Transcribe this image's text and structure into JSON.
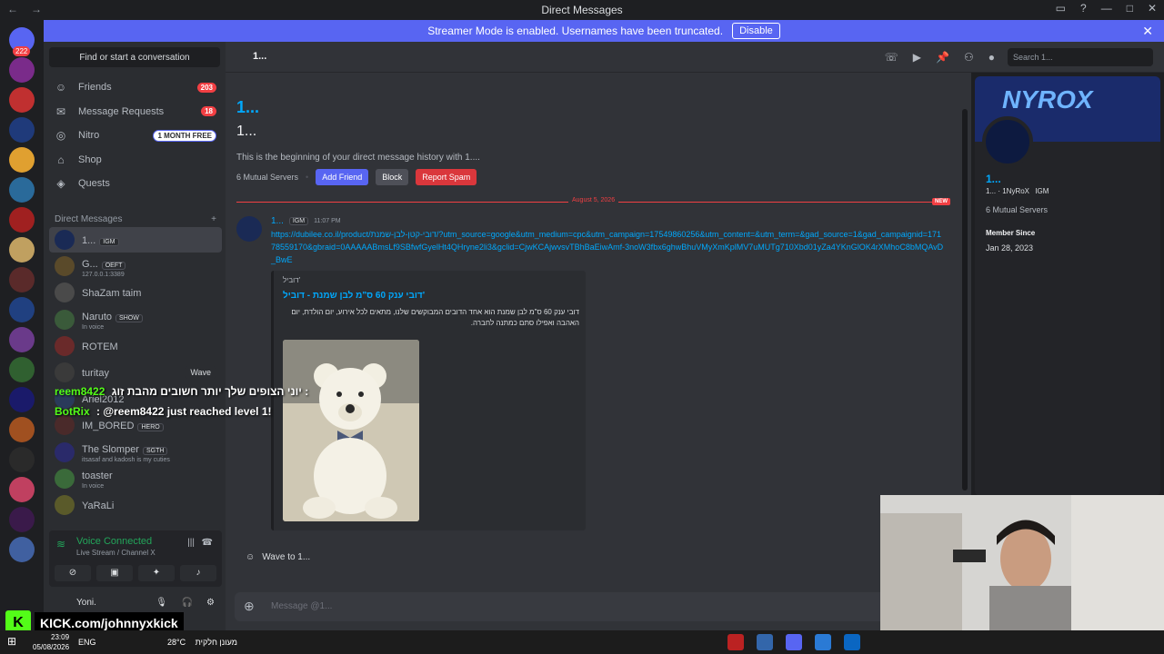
{
  "window": {
    "title": "Direct Messages"
  },
  "banner": {
    "text": "Streamer Mode is enabled. Usernames have been truncated.",
    "disable": "Disable"
  },
  "guilds": {
    "badge": "222",
    "colors": [
      "#5865f2",
      "#7a2b8a",
      "#c03030",
      "#1f3a7a",
      "#e0a030",
      "#2a6a9a",
      "#a02020",
      "#c0a060",
      "#5a2a2a",
      "#204080",
      "#6a3a8a",
      "#306030",
      "#1a1a6a",
      "#a05020",
      "#2a2a2a",
      "#c04060",
      "#3a1a4a",
      "#4060a0"
    ]
  },
  "sidebar": {
    "find": "Find or start a conversation",
    "nav": [
      {
        "label": "Friends",
        "icon": "friends-icon",
        "badge": "203"
      },
      {
        "label": "Message Requests",
        "icon": "mail-icon",
        "badge": "18"
      },
      {
        "label": "Nitro",
        "icon": "nitro-icon",
        "badge": "1 MONTH FREE"
      },
      {
        "label": "Shop",
        "icon": "shop-icon",
        "badge": ""
      },
      {
        "label": "Quests",
        "icon": "quests-icon",
        "badge": ""
      }
    ],
    "dm_header": "Direct Messages",
    "dms": [
      {
        "name": "1...",
        "tag": "IGM",
        "sub": ""
      },
      {
        "name": "G...",
        "tag": "OEFT",
        "sub": "127.0.0.1:3389"
      },
      {
        "name": "ShaZam taim",
        "tag": "",
        "sub": ""
      },
      {
        "name": "Naruto",
        "tag": "SHOW",
        "sub": "In voice"
      },
      {
        "name": "ROTEM",
        "tag": "",
        "sub": ""
      },
      {
        "name": "turitay",
        "tag": "",
        "sub": ""
      },
      {
        "name": "Ariel2012",
        "tag": "",
        "sub": ""
      },
      {
        "name": "IM_BORED",
        "tag": "HERO",
        "sub": ""
      },
      {
        "name": "The Slomper",
        "tag": "SGTH",
        "sub": "itsasaf and kadosh is my cuties"
      },
      {
        "name": "toaster",
        "tag": "",
        "sub": "In voice"
      },
      {
        "name": "YaRaLi",
        "tag": "",
        "sub": ""
      }
    ],
    "wave_label": "Wave",
    "voice": {
      "title": "Voice Connected",
      "sub": "Live Stream / Channel X"
    },
    "user": "Yoni."
  },
  "topbar": {
    "name": "1...",
    "search": "Search 1..."
  },
  "main": {
    "big_title": "1...",
    "sub_title": "1...",
    "begin": "This is the beginning of your direct message history with 1....",
    "mutual": "6 Mutual Servers",
    "add_friend": "Add Friend",
    "block": "Block",
    "report": "Report Spam",
    "date": "August 5, 2026",
    "new": "NEW",
    "msg": {
      "author": "1...",
      "tag": "IGM",
      "time": "11:07 PM",
      "link": "https://dubilee.co.il/product/דובי-קטן-לבן-שמנת/?utm_source=google&utm_medium=cpc&utm_campaign=17549860256&utm_content=&utm_term=&gad_source=1&gad_campaignid=17178559170&gbraid=0AAAAABmsLf9SBfwfGyelHt4QHryne2li3&gclid=CjwKCAjwvsvTBhBaEiwAmf-3noW3fbx6ghwBhuVMyXmKplMV7uMUTg710Xbd01yZa4YKnGlOK4rXMhoC8bMQAvD_BwE",
      "embed_provider": "דוביל'",
      "embed_title": "דובי ענק 60 ס\"מ לבן שמנת - דוביל'",
      "embed_desc": "דובי ענק 60 ס\"מ לבן שמנת הוא אחד הדובים המבוקשים שלנו, מתאים לכל אירוע, יום הולדת, יום האהבה ואפילו סתם כמתנה לחברה."
    },
    "wave": "Wave to 1...",
    "composer": "Message @1..."
  },
  "profile": {
    "name": "1...",
    "user": "1... · 1NyRoX",
    "tag": "IGM",
    "mutual": "6 Mutual Servers",
    "member_since": "Member Since",
    "date": "Jan 28, 2023",
    "banner_text": "NYROX"
  },
  "overlay": {
    "line1_user": "reem8422",
    "line1_text": "יוני הצופים שלך יותר חשובים מהבת זוג :",
    "line2_user": "BotRix",
    "line2_text": ": @reem8422 just reached level 1!"
  },
  "kick": {
    "url": "KICK.com/johnnyxkick"
  },
  "taskbar": {
    "time": "23:09",
    "date": "05/08/2026",
    "lang": "ENG",
    "weather": "28°C",
    "weather_text": "מעונן חלקית"
  }
}
